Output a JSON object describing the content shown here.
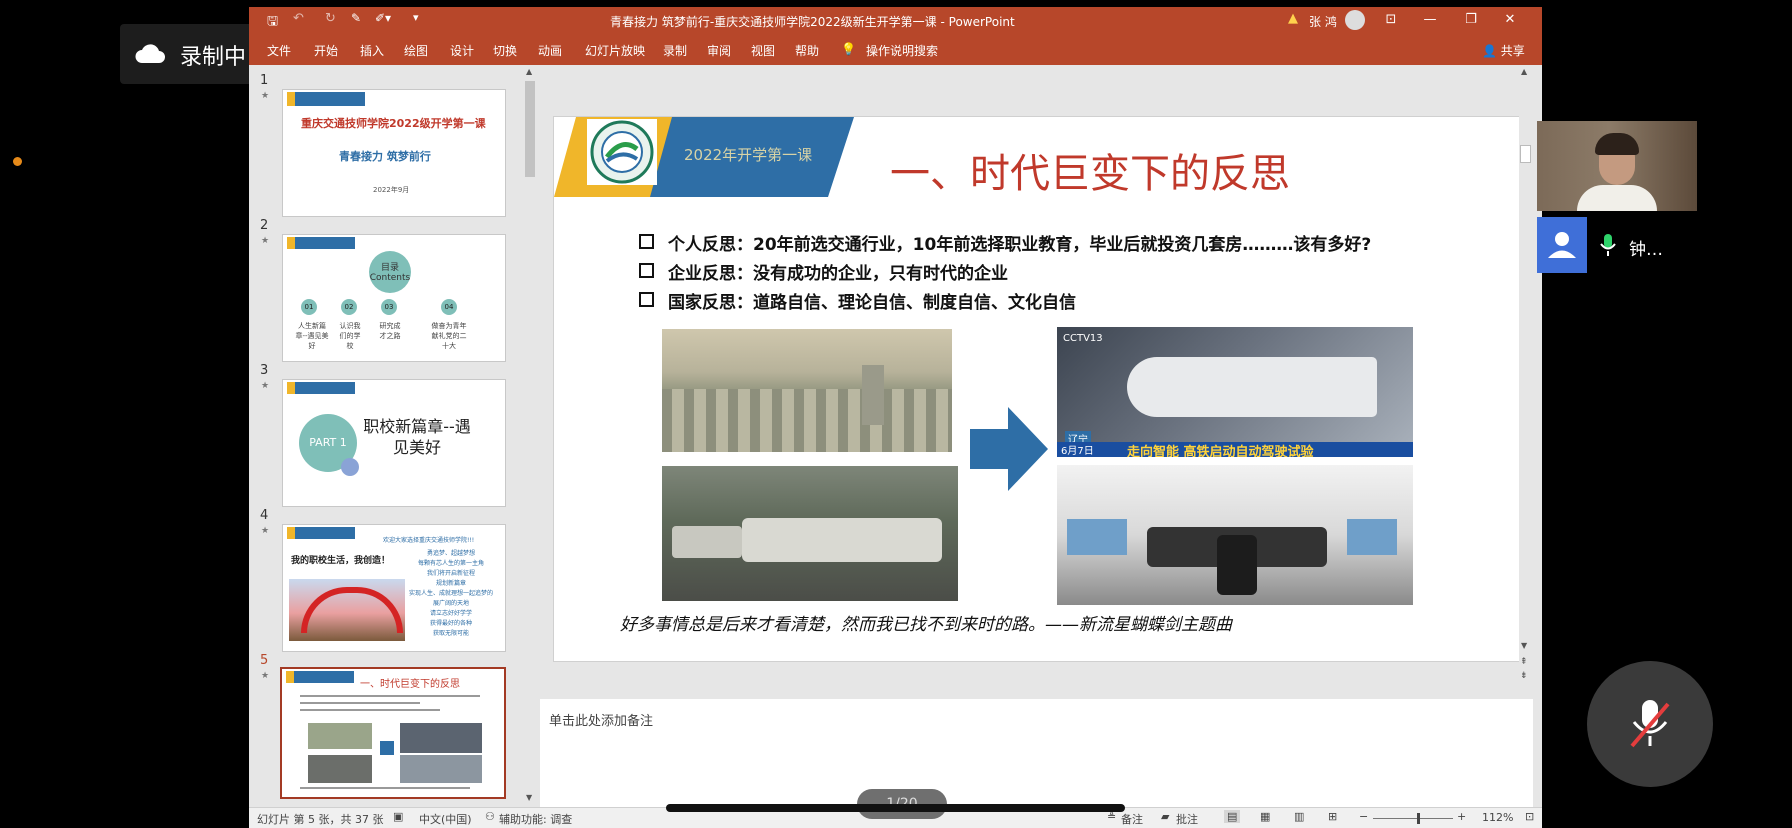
{
  "recording": {
    "label": "录制中",
    "icon": "cloud-icon"
  },
  "window": {
    "title": "青春接力 筑梦前行-重庆交通技师学院2022级新生开学第一课 - PowerPoint",
    "user": "张 鸿"
  },
  "ribbon": {
    "tabs": [
      "文件",
      "开始",
      "插入",
      "绘图",
      "设计",
      "切换",
      "动画",
      "幻灯片放映",
      "录制",
      "审阅",
      "视图",
      "帮助"
    ],
    "search": "操作说明搜索",
    "share": "共享"
  },
  "thumbnails": {
    "items": [
      {
        "num": "1",
        "title": "重庆交通技师学院2022级开学第一课",
        "subtitle": "青春接力 筑梦前行",
        "date": "2022年9月"
      },
      {
        "num": "2",
        "center": "目录",
        "center2": "Contents",
        "chapters": [
          {
            "n": "01",
            "t": "人生新篇章--遇见美好"
          },
          {
            "n": "02",
            "t": "认识我们的学校"
          },
          {
            "n": "03",
            "t": "研究成才之路"
          },
          {
            "n": "04",
            "t": "做奋为青年献礼党的二十大"
          }
        ]
      },
      {
        "num": "3",
        "part": "PART 1",
        "title": "职校新篇章--遇见美好"
      },
      {
        "num": "4",
        "title": "我的职校生活，我创造！",
        "header": "欢迎大家选择重庆交通技师学院!!!",
        "lines": [
          "勇追梦、超越梦想",
          "每颗有芯人生的第一主角",
          "我们将开启新征程",
          "规划新篇章",
          "实现人生、成就理想一起追梦的",
          "展广阔的天地",
          "请立志好好学学",
          "获得最好的各种",
          "获取无限可能"
        ]
      },
      {
        "num": "5",
        "title": "一、时代巨变下的反思"
      }
    ]
  },
  "slide": {
    "banner": "2022年开学第一课",
    "title": "一、时代巨变下的反思",
    "bullets": [
      "个人反思：20年前选交通行业，10年前选择职业教育，毕业后就投资几套房………该有多好?",
      "企业反思：没有成功的企业，只有时代的企业",
      "国家反思：道路自信、理论自信、制度自信、文化自信"
    ],
    "images": {
      "top_left": "old city skyline",
      "bottom_left": "buses on street",
      "top_right_caption": "走向智能 高铁启动自动驾驶试验",
      "top_right_channel": "CCTV13",
      "top_right_date": "6月7日",
      "top_right_region": "辽宁",
      "bottom_right": "train cockpit"
    },
    "quote": "好多事情总是后来才看清楚，然而我已找不到来时的路。——新流星蝴蝶剑主题曲"
  },
  "notes": {
    "placeholder": "单击此处添加备注"
  },
  "status": {
    "slide_info": "幻灯片 第 5 张，共 37 张",
    "language": "中文(中国)",
    "accessibility": "辅助功能: 调查",
    "notes_btn": "备注",
    "comments_btn": "批注",
    "zoom": "112%"
  },
  "meeting": {
    "attendee": "钟…",
    "page_indicator": "1/20"
  },
  "colors": {
    "accent": "#b7472a",
    "slide_title": "#c0392b",
    "banner_blue": "#2e6ea6",
    "banner_gold": "#f0b62a"
  }
}
